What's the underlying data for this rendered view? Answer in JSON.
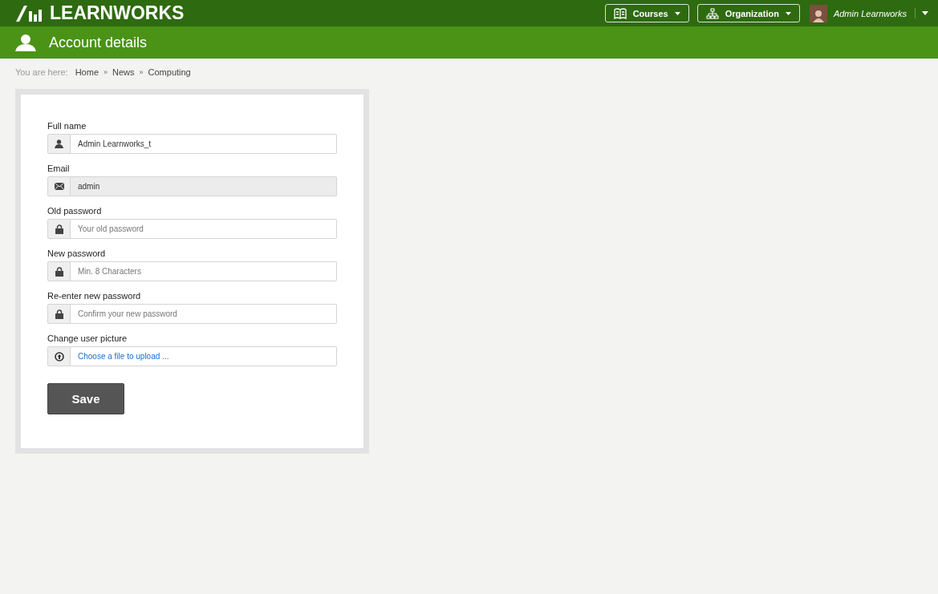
{
  "brand": {
    "name": "LEARNWORKS"
  },
  "nav": [
    {
      "label": "Courses"
    },
    {
      "label": "Organization"
    }
  ],
  "user": {
    "name": "Admin Learnworks"
  },
  "page_title": "Account details",
  "breadcrumb": {
    "prefix": "You are here:",
    "items": [
      "Home",
      "News",
      "Computing"
    ],
    "separator": "»"
  },
  "fields": [
    {
      "label": "Full name",
      "kind": "name",
      "value": "Admin Learnworks_t",
      "disabled": false
    },
    {
      "label": "Email",
      "kind": "email",
      "value": "admin",
      "disabled": true
    },
    {
      "label": "Old password",
      "kind": "password",
      "placeholder": "Your old password",
      "disabled": false
    },
    {
      "label": "New password",
      "kind": "password",
      "placeholder": "Min. 8 Characters",
      "disabled": false
    },
    {
      "label": "Re-enter new password",
      "kind": "password",
      "placeholder": "Confirm your new password",
      "disabled": false
    },
    {
      "label": "Change user picture",
      "kind": "file",
      "link": "Choose a file to upload ...",
      "disabled": false
    }
  ],
  "save_button": "Save"
}
